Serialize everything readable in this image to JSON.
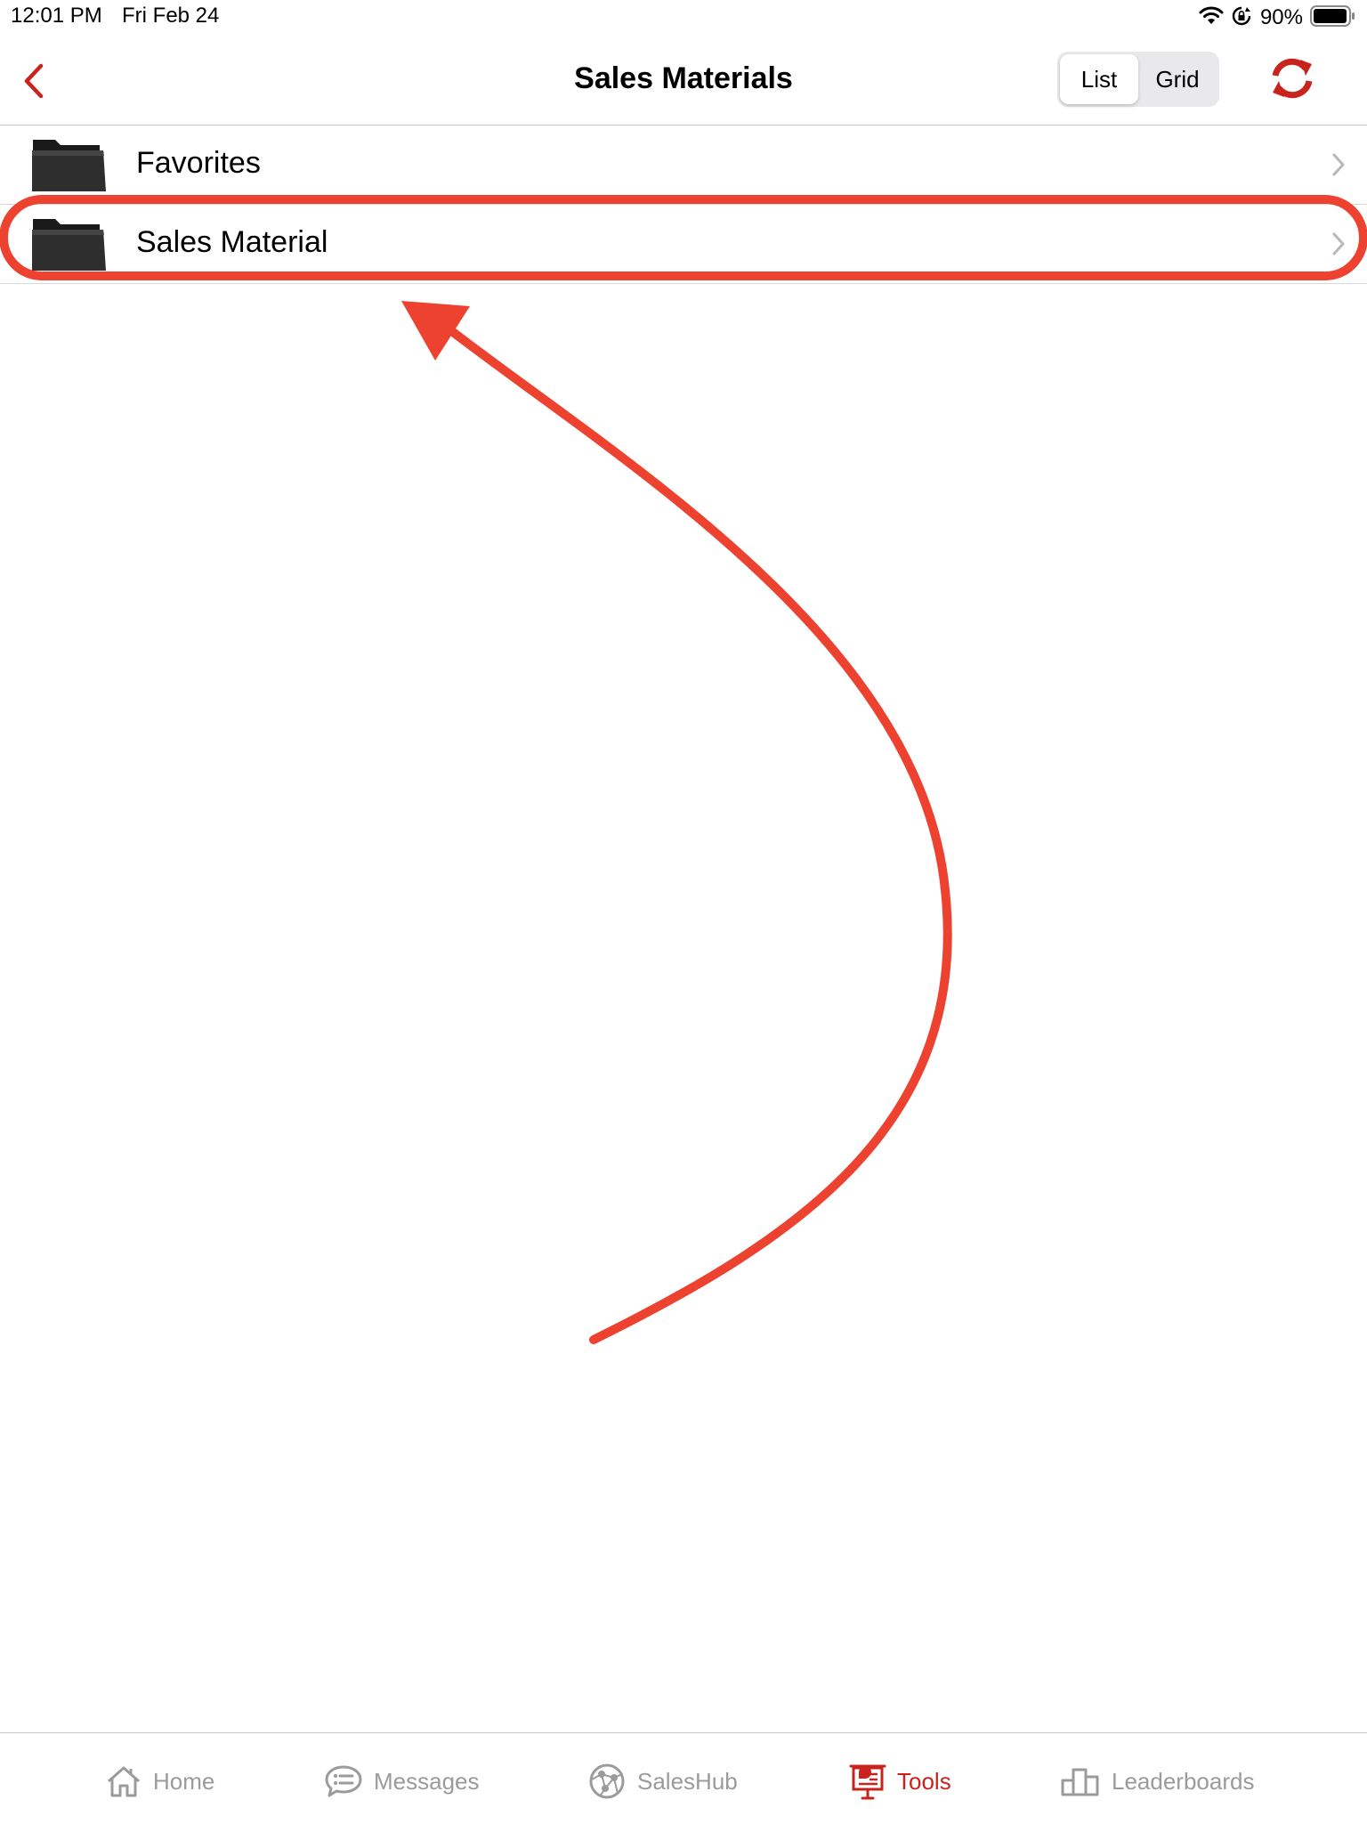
{
  "status_bar": {
    "time": "12:01 PM",
    "date": "Fri Feb 24",
    "battery": "90%"
  },
  "nav": {
    "title": "Sales Materials",
    "view_toggle": {
      "list_label": "List",
      "grid_label": "Grid",
      "selected": "List"
    }
  },
  "list": {
    "items": [
      {
        "label": "Favorites"
      },
      {
        "label": "Sales Material"
      }
    ]
  },
  "tab_bar": {
    "tabs": [
      {
        "label": "Home"
      },
      {
        "label": "Messages"
      },
      {
        "label": "SalesHub"
      },
      {
        "label": "Tools"
      },
      {
        "label": "Leaderboards"
      }
    ],
    "active": "Tools"
  },
  "colors": {
    "accent": "#c8241d",
    "annotation": "#ee4231",
    "inactive_tab": "#9b9b9b",
    "folder": "#2e2e2e"
  }
}
